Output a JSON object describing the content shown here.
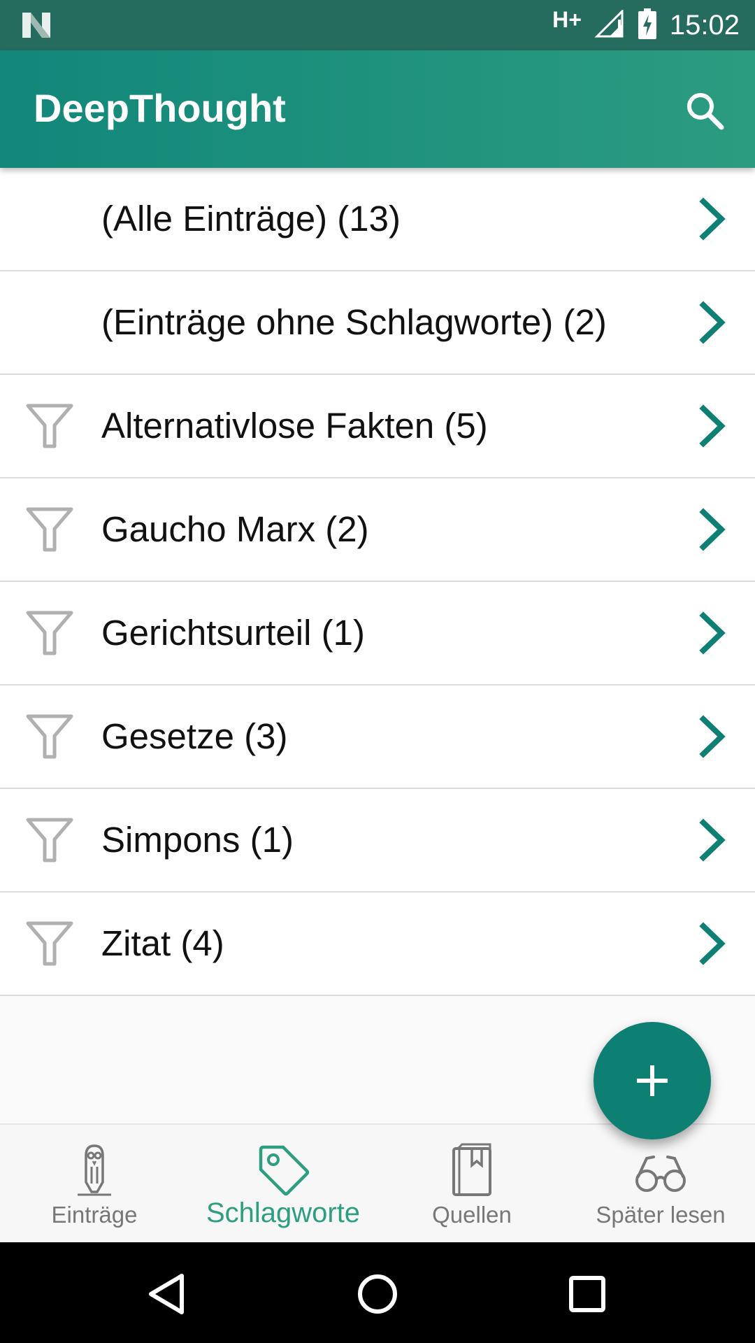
{
  "status_bar": {
    "network": "H+",
    "time": "15:02",
    "icons": [
      "notification-n-icon",
      "signal-icon",
      "battery-charging-icon"
    ]
  },
  "app_bar": {
    "title": "DeepThought",
    "search_icon": "search-icon"
  },
  "tags": [
    {
      "label": "(Alle Einträge) (13)",
      "filter_icon": false
    },
    {
      "label": "(Einträge ohne Schlagworte) (2)",
      "filter_icon": false
    },
    {
      "label": "Alternativlose Fakten (5)",
      "filter_icon": true
    },
    {
      "label": "Gaucho Marx (2)",
      "filter_icon": true
    },
    {
      "label": "Gerichtsurteil (1)",
      "filter_icon": true
    },
    {
      "label": "Gesetze (3)",
      "filter_icon": true
    },
    {
      "label": "Simpons (1)",
      "filter_icon": true
    },
    {
      "label": "Zitat (4)",
      "filter_icon": true
    }
  ],
  "fab": {
    "icon": "plus-icon"
  },
  "bottom_nav": {
    "items": [
      {
        "label": "Einträge",
        "icon": "owl-pen-icon",
        "active": false
      },
      {
        "label": "Schlagworte",
        "icon": "tag-icon",
        "active": true
      },
      {
        "label": "Quellen",
        "icon": "book-icon",
        "active": false
      },
      {
        "label": "Später lesen",
        "icon": "glasses-icon",
        "active": false
      }
    ]
  },
  "colors": {
    "accent": "#0e8073",
    "active_tab": "#2e9e80",
    "status_bar": "#256b5e"
  }
}
